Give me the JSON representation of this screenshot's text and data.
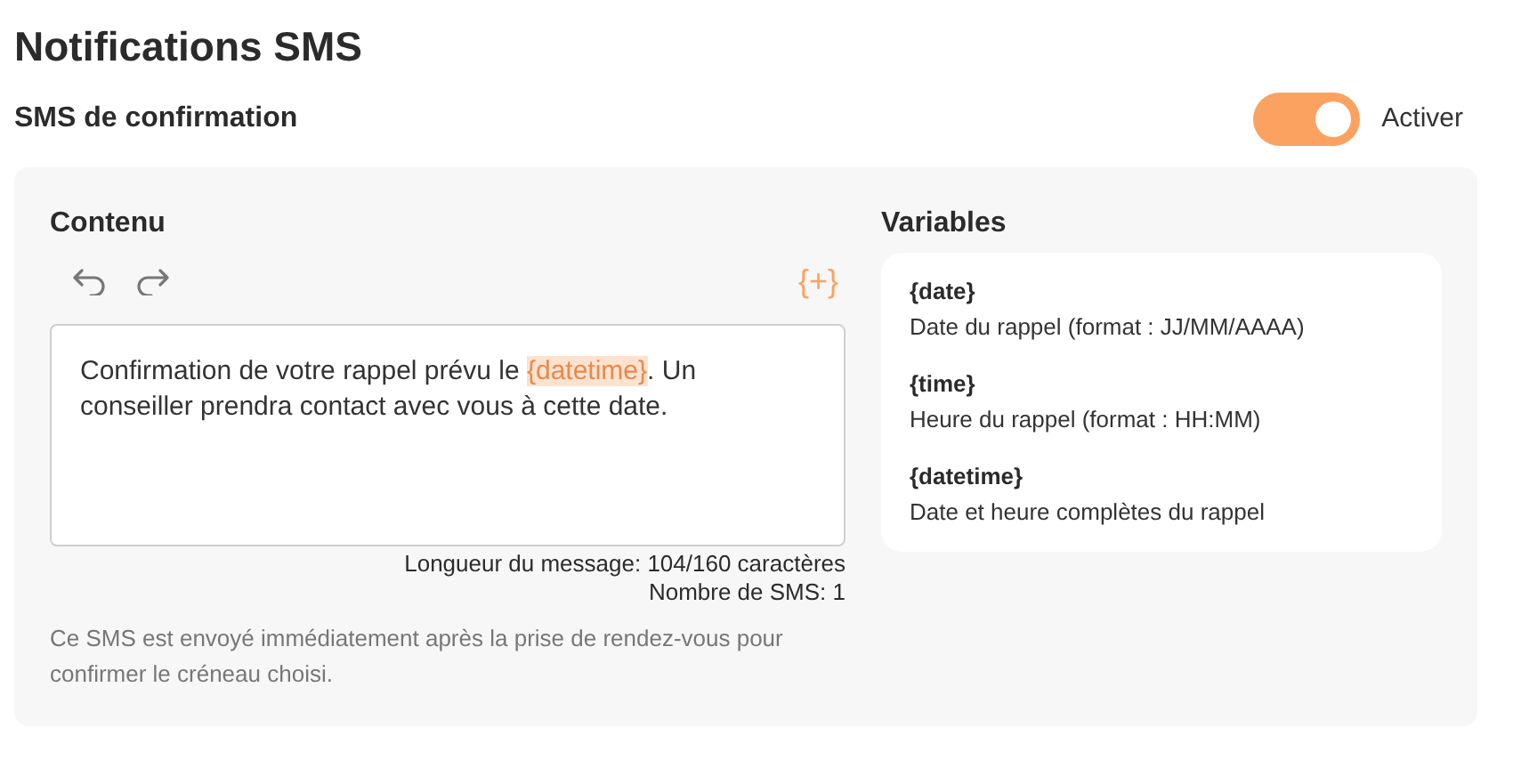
{
  "title": "Notifications SMS",
  "section": {
    "title": "SMS de confirmation",
    "toggle": {
      "on": true,
      "label": "Activer"
    }
  },
  "content": {
    "title": "Contenu",
    "insert_button": "{+}",
    "message": [
      {
        "kind": "text",
        "text": "Confirmation de votre rappel prévu le "
      },
      {
        "kind": "variable",
        "text": "{datetime}"
      },
      {
        "kind": "text",
        "text": ". Un conseiller prendra contact avec vous à cette date."
      }
    ],
    "length": "Longueur du message: 104/160 caractères",
    "count": "Nombre de SMS: 1",
    "help": "Ce SMS est envoyé immédiatement après la prise de rendez-vous pour confirmer le créneau choisi."
  },
  "variables": {
    "title": "Variables",
    "items": [
      {
        "name": "{date}",
        "description": "Date du rappel (format : JJ/MM/AAAA)"
      },
      {
        "name": "{time}",
        "description": "Heure du rappel (format : HH:MM)"
      },
      {
        "name": "{datetime}",
        "description": "Date et heure complètes du rappel"
      }
    ]
  }
}
